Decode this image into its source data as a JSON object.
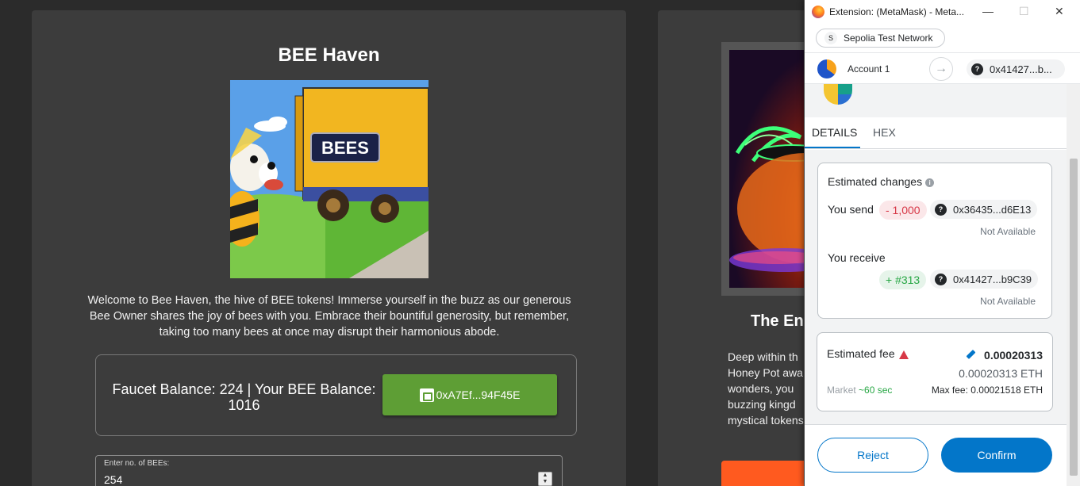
{
  "dapp": {
    "title": "BEE Haven",
    "hero_sign": "BEES",
    "description": "Welcome to Bee Haven, the hive of BEE tokens! Immerse yourself in the buzz as our generous Bee Owner shares the joy of bees with you. Embrace their bountiful generosity, but remember, taking too many bees at once may disrupt their harmonious abode.",
    "balance_text": "Faucet Balance: 224 | Your BEE Balance: 1016",
    "wallet_button": "0xA7Ef...94F45E",
    "input_label": "Enter no. of BEEs:",
    "input_value": "254"
  },
  "dapp2": {
    "title": "The En",
    "description_lines": [
      "Deep within th",
      "Honey Pot awa",
      "wonders, you",
      "buzzing kingd",
      "mystical tokens"
    ]
  },
  "metamask": {
    "window_title": "Extension: (MetaMask) - Meta...",
    "network_initial": "S",
    "network": "Sepolia Test Network",
    "from_account": "Account 1",
    "to_address": "0x41427...b...",
    "tabs": [
      "DETAILS",
      "HEX"
    ],
    "estimated_changes_title": "Estimated changes",
    "you_send_label": "You send",
    "send_amount": "- 1,000",
    "send_address": "0x36435...d6E13",
    "send_fiat": "Not Available",
    "you_receive_label": "You receive",
    "receive_amount": "+ #313",
    "receive_address": "0x41427...b9C39",
    "receive_fiat": "Not Available",
    "estimated_fee_title": "Estimated fee",
    "fee_amount": "0.00020313",
    "fee_eth": "0.00020313 ETH",
    "market_label": "Market",
    "market_time": "~60 sec",
    "max_fee": "Max fee: 0.00021518 ETH",
    "reject_label": "Reject",
    "confirm_label": "Confirm"
  },
  "colors": {
    "accent": "#0376c9",
    "wallet_button": "#5e9e35",
    "danger": "#d73847",
    "success": "#28a745"
  }
}
